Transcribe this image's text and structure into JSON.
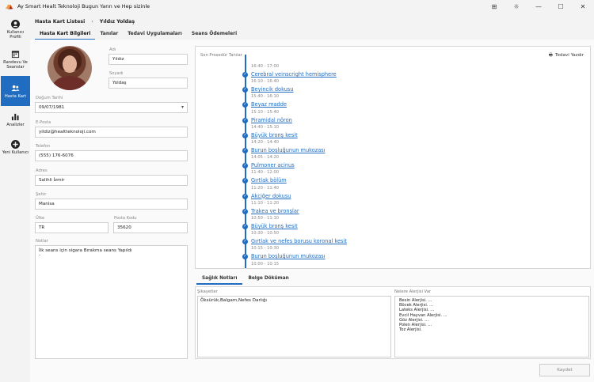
{
  "window": {
    "title": "Ay Smart Healt Teknoloji  Bugun Yarın ve Hep sizinle"
  },
  "sidebar": {
    "items": [
      {
        "label": "Kullanıcı Profili",
        "icon": "user-circle-icon"
      },
      {
        "label": "Randevu Ve Seanslar",
        "icon": "calendar-icon"
      },
      {
        "label": "Hasta Kart",
        "icon": "users-icon"
      },
      {
        "label": "Analizler",
        "icon": "bar-chart-icon"
      },
      {
        "label": "Yeni Kullanıcı",
        "icon": "plus-circle-icon"
      }
    ]
  },
  "header": {
    "breadcrumb": [
      "Hasta Kart Listesi",
      "Yıldız  Yoldaş"
    ],
    "tabs": [
      "Hasta Kart Bilgileri",
      "Tanılar",
      "Tedavi Uygulamaları",
      "Seans Ödemeleri"
    ]
  },
  "form": {
    "ad_label": "Adı",
    "ad": "Yıldız",
    "soyad_label": "Soyadı",
    "soyad": "Yoldaş",
    "dogum_label": "Doğum Tarihi",
    "dogum": "09/07/1981",
    "eposta_label": "E-Posta",
    "eposta": "yildiz@healtteknoloji.com",
    "telefon_label": "Telefon",
    "telefon": "(555) 176-6076",
    "adres_label": "Adres",
    "adres": "Salihli İzmir",
    "sehir_label": "Şehir",
    "sehir": "Manisa",
    "ulke_label": "Ülke",
    "ulke": "TR",
    "postakodu_label": "Posta Kodu",
    "postakodu": "35620",
    "notlar_label": "Notlar",
    "notlar": "İlk seans için sigara Bırakma seans Yapıldı\n-"
  },
  "procedures": {
    "title": "Son Prosedür Tanılar",
    "print_label": "Tedavi Yazdır",
    "items": [
      {
        "time": "16:40 - 17:00",
        "name": "Cerebral veinscright hemisphere"
      },
      {
        "time": "16:10 - 16:40",
        "name": "Beyincik dokusu"
      },
      {
        "time": "15:40 - 16:10",
        "name": "Beyaz madde"
      },
      {
        "time": "15:10 - 15:40",
        "name": "Piramidal nöron"
      },
      {
        "time": "14:40 - 15:10",
        "name": "Büyük bronş kesit"
      },
      {
        "time": "14:20 - 14:40",
        "name": "Burun boşluğunun mukozası"
      },
      {
        "time": "14:05 - 14:20",
        "name": "Pulmoner acinus"
      },
      {
        "time": "11:40 - 12:00",
        "name": "Gırtlak bölüm"
      },
      {
        "time": "11:20 - 11:40",
        "name": "Akciğer dokusu"
      },
      {
        "time": "11:10 - 11:20",
        "name": "Trakea ve bronşlar"
      },
      {
        "time": "10:50 - 11:10",
        "name": "Büyük bronş kesit"
      },
      {
        "time": "10:30 - 10:50",
        "name": "Gırtlak ve nefes borusu koronal kesit"
      },
      {
        "time": "10:15 - 10:30",
        "name": "Burun boşluğunun mukozası"
      },
      {
        "time": "10:00 - 10:15",
        "name": ""
      }
    ]
  },
  "bottom": {
    "tabs": [
      "Sağlık Notları",
      "Belge Döküman"
    ],
    "sikayetler_label": "Şikayetler",
    "sikayetler": "Öksürük,Balgam,Nefes Darlığı",
    "alerji_label": "Nelere Alerjisi Var",
    "alerjiler": [
      "Besin Alerjisi. ...",
      "Böcek Alerjisi. ...",
      "Lateks Alerjisi. ...",
      "Evcil Hayvan Alerjisi. ...",
      "Göz Alerjisi. ...",
      "Polen Alerjisi. ...",
      "Toz Alerjisi."
    ]
  },
  "actions": {
    "save_label": "Kaydet"
  },
  "colors": {
    "accent": "#1f6cc1"
  }
}
